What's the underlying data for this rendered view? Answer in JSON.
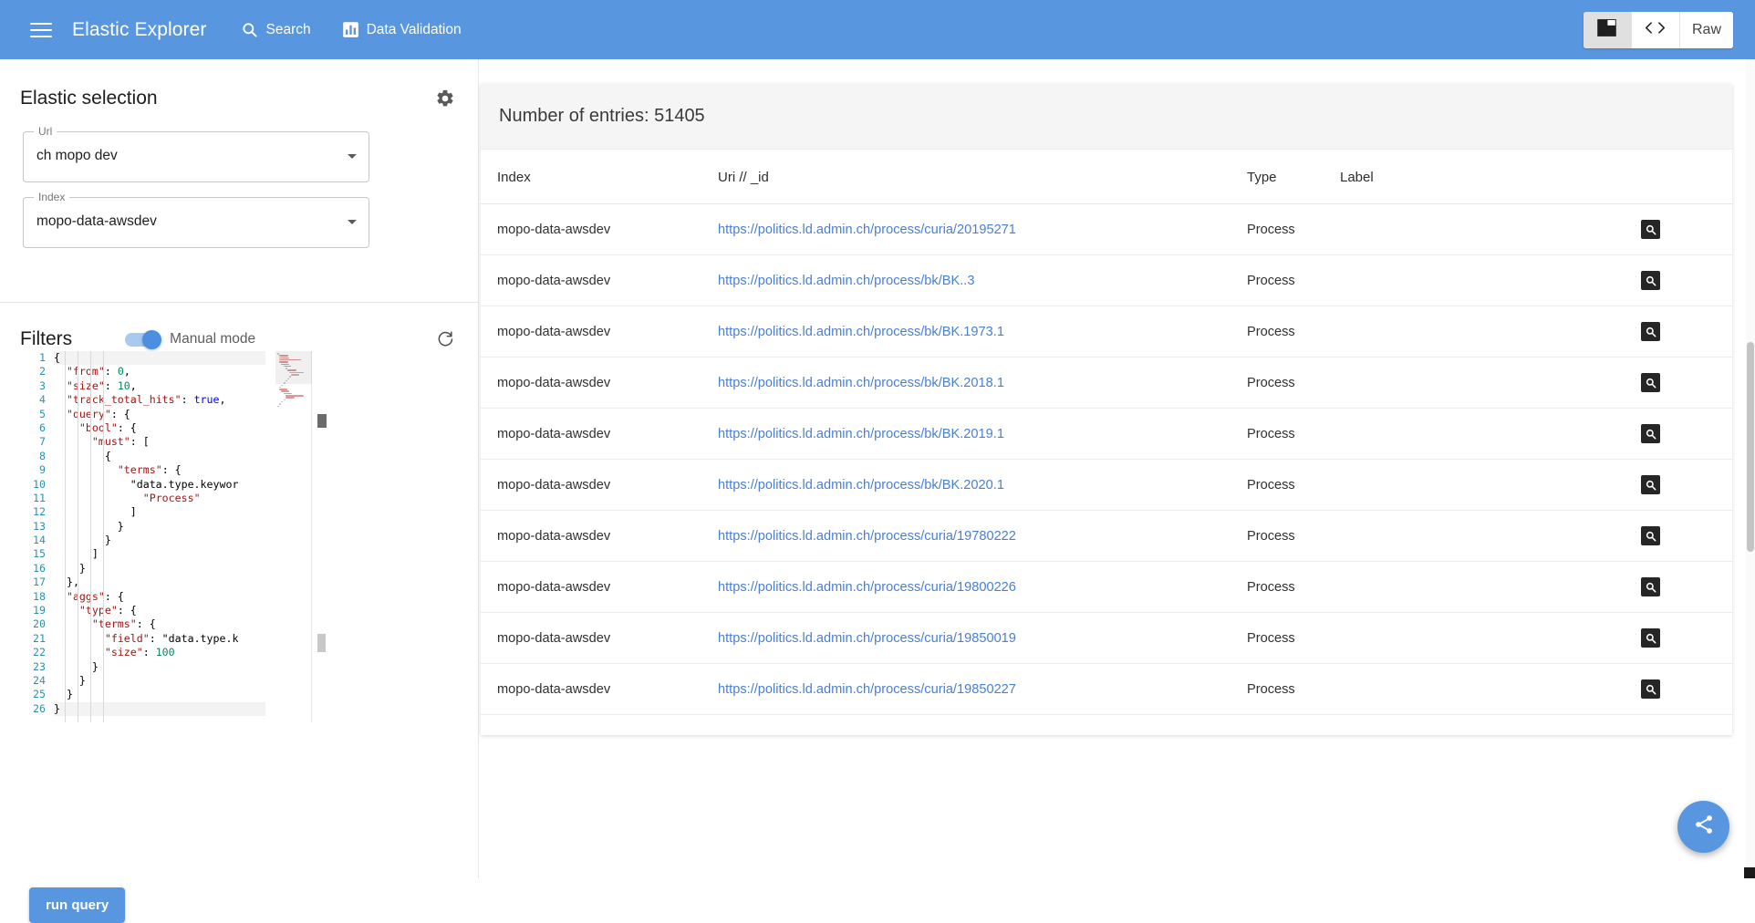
{
  "appbar": {
    "menu_icon": "hamburger-icon",
    "title": "Elastic Explorer",
    "nav": [
      {
        "icon": "search-icon",
        "label": "Search"
      },
      {
        "icon": "chart-bar-icon",
        "label": "Data Validation"
      }
    ],
    "view_modes": [
      {
        "id": "panel",
        "label": "",
        "icon": "panel-view-icon",
        "active": true
      },
      {
        "id": "code",
        "label": "",
        "icon": "code-brackets-icon",
        "active": false
      },
      {
        "id": "raw",
        "label": "Raw",
        "icon": "",
        "active": false
      }
    ],
    "brand_color": "#5897df"
  },
  "sidebar": {
    "elastic_selection": {
      "title": "Elastic selection",
      "settings_icon": "gear-icon",
      "fields": [
        {
          "legend": "Url",
          "value": "ch mopo dev"
        },
        {
          "legend": "Index",
          "value": "mopo-data-awsdev"
        }
      ]
    },
    "filters": {
      "title": "Filters",
      "toggle_label": "Manual mode",
      "toggle_on": true,
      "refresh_icon": "refresh-icon",
      "run_button": "run query",
      "editor": {
        "lines": [
          {
            "n": "1",
            "text": "{"
          },
          {
            "n": "2",
            "text": "  \"from\": 0,"
          },
          {
            "n": "3",
            "text": "  \"size\": 10,"
          },
          {
            "n": "4",
            "text": "  \"track_total_hits\": true,"
          },
          {
            "n": "5",
            "text": "  \"query\": {"
          },
          {
            "n": "6",
            "text": "    \"bool\": {"
          },
          {
            "n": "7",
            "text": "      \"must\": ["
          },
          {
            "n": "8",
            "text": "        {"
          },
          {
            "n": "9",
            "text": "          \"terms\": {"
          },
          {
            "n": "10",
            "text": "            \"data.type.keywor"
          },
          {
            "n": "11",
            "text": "              \"Process\""
          },
          {
            "n": "12",
            "text": "            ]"
          },
          {
            "n": "13",
            "text": "          }"
          },
          {
            "n": "14",
            "text": "        }"
          },
          {
            "n": "15",
            "text": "      ]"
          },
          {
            "n": "16",
            "text": "    }"
          },
          {
            "n": "17",
            "text": "  },"
          },
          {
            "n": "18",
            "text": "  \"aggs\": {"
          },
          {
            "n": "19",
            "text": "    \"type\": {"
          },
          {
            "n": "20",
            "text": "      \"terms\": {"
          },
          {
            "n": "21",
            "text": "        \"field\": \"data.type.k"
          },
          {
            "n": "22",
            "text": "        \"size\": 100"
          },
          {
            "n": "23",
            "text": "      }"
          },
          {
            "n": "24",
            "text": "    }"
          },
          {
            "n": "25",
            "text": "  }"
          },
          {
            "n": "26",
            "text": "}"
          }
        ]
      }
    }
  },
  "main": {
    "entries_label": "Number of entries: 51405",
    "columns": [
      "Index",
      "Uri // _id",
      "Type",
      "Label",
      ""
    ],
    "row_action_icon": "magnifier-inspect-icon",
    "rows": [
      {
        "index": "mopo-data-awsdev",
        "uri": "https://politics.ld.admin.ch/process/curia/20195271",
        "type": "Process",
        "label": ""
      },
      {
        "index": "mopo-data-awsdev",
        "uri": "https://politics.ld.admin.ch/process/bk/BK..3",
        "type": "Process",
        "label": ""
      },
      {
        "index": "mopo-data-awsdev",
        "uri": "https://politics.ld.admin.ch/process/bk/BK.1973.1",
        "type": "Process",
        "label": ""
      },
      {
        "index": "mopo-data-awsdev",
        "uri": "https://politics.ld.admin.ch/process/bk/BK.2018.1",
        "type": "Process",
        "label": ""
      },
      {
        "index": "mopo-data-awsdev",
        "uri": "https://politics.ld.admin.ch/process/bk/BK.2019.1",
        "type": "Process",
        "label": ""
      },
      {
        "index": "mopo-data-awsdev",
        "uri": "https://politics.ld.admin.ch/process/bk/BK.2020.1",
        "type": "Process",
        "label": ""
      },
      {
        "index": "mopo-data-awsdev",
        "uri": "https://politics.ld.admin.ch/process/curia/19780222",
        "type": "Process",
        "label": ""
      },
      {
        "index": "mopo-data-awsdev",
        "uri": "https://politics.ld.admin.ch/process/curia/19800226",
        "type": "Process",
        "label": ""
      },
      {
        "index": "mopo-data-awsdev",
        "uri": "https://politics.ld.admin.ch/process/curia/19850019",
        "type": "Process",
        "label": ""
      },
      {
        "index": "mopo-data-awsdev",
        "uri": "https://politics.ld.admin.ch/process/curia/19850227",
        "type": "Process",
        "label": ""
      }
    ],
    "fab_icon": "share-icon"
  }
}
